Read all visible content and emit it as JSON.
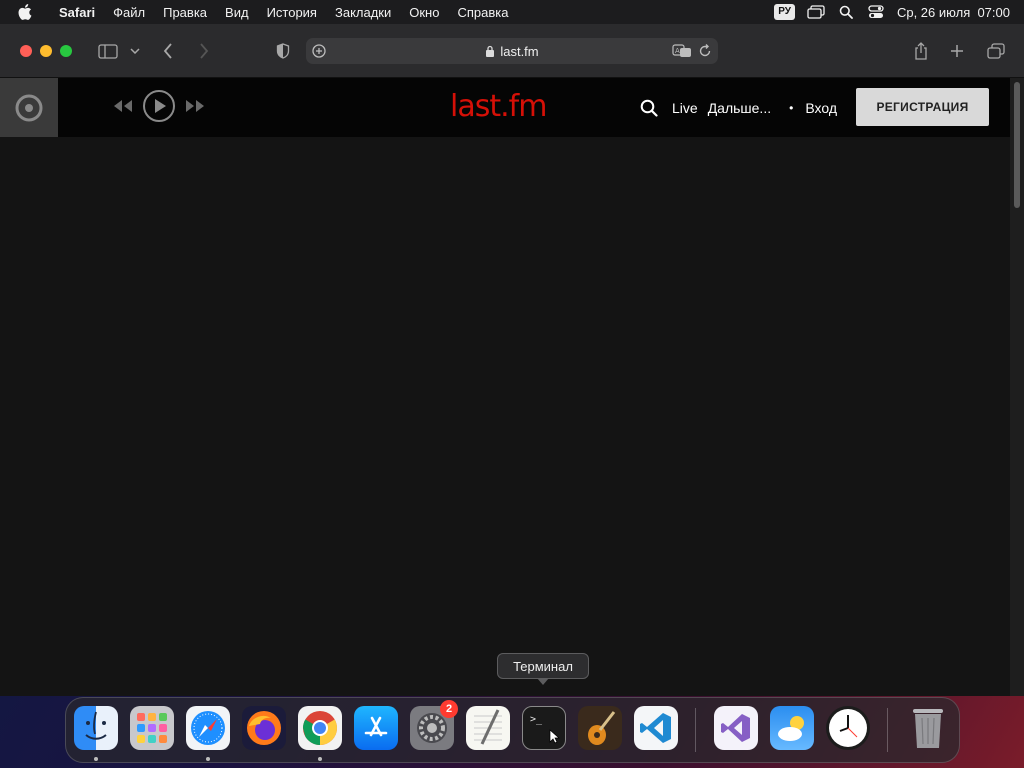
{
  "menubar": {
    "apple_icon": "apple-logo-icon",
    "items": [
      "Safari",
      "Файл",
      "Правка",
      "Вид",
      "История",
      "Закладки",
      "Окно",
      "Справка"
    ],
    "input_language": "РУ",
    "datetime": "Ср, 26 июля  07:00"
  },
  "safari": {
    "url": "last.fm",
    "icons": [
      "sidebar-icon",
      "back-icon",
      "forward-icon",
      "privacy-shield-icon",
      "page-menu-icon",
      "lock-icon",
      "translate-icon",
      "reload-icon",
      "share-icon",
      "new-tab-icon",
      "tab-overview-icon"
    ]
  },
  "lastfm": {
    "logo": "last.fm",
    "nav": {
      "live": "Live",
      "more": "Дальше...",
      "separator": "•",
      "login": "Вход",
      "register": "РЕГИСТРАЦИЯ"
    },
    "brand_color": "#d51007"
  },
  "tooltip": "Терминал",
  "dock": {
    "apps": [
      "Finder",
      "Launchpad",
      "Safari",
      "Firefox",
      "Google Chrome",
      "App Store",
      "Системные настройки",
      "TextEdit",
      "Терминал",
      "GarageBand",
      "Visual Studio Code",
      "Visual Studio",
      "Погода",
      "Часы",
      "Корзина"
    ],
    "settings_badge": "2"
  }
}
